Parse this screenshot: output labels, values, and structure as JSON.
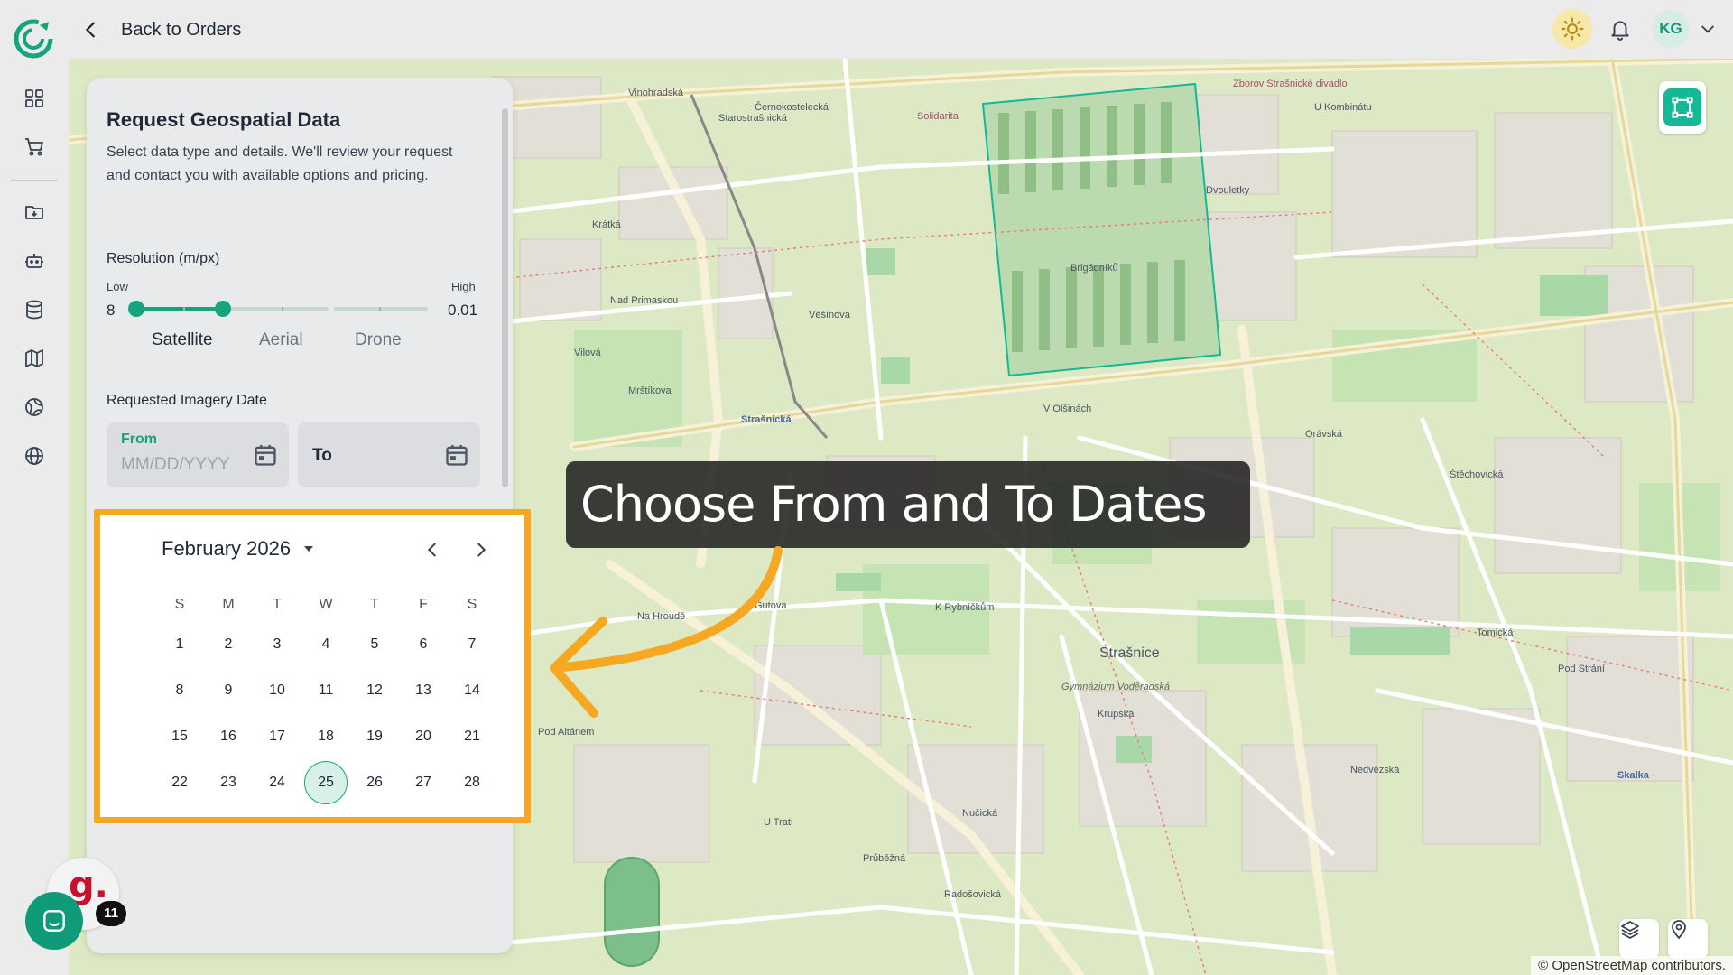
{
  "header": {
    "back_label": "Back to Orders",
    "avatar_initials": "KG"
  },
  "sidebar": {
    "icons": [
      "dashboard-icon",
      "cart-icon",
      "folder-icon",
      "robot-icon",
      "database-icon",
      "map-icon",
      "globe-grid-icon",
      "globe-icon"
    ]
  },
  "panel": {
    "title": "Request Geospatial Data",
    "description": "Select data type and details. We'll review your request and contact you with available options and pricing.",
    "resolution": {
      "label": "Resolution (m/px)",
      "low_label": "Low",
      "high_label": "High",
      "min_value": "8",
      "max_value": "0.01",
      "selected_fraction": 0.3,
      "sources": [
        "Satellite",
        "Aerial",
        "Drone"
      ],
      "active_source": "Satellite"
    },
    "date": {
      "label": "Requested Imagery Date",
      "from_label": "From",
      "from_placeholder": "MM/DD/YYYY",
      "to_label": "To"
    }
  },
  "calendar": {
    "month_label": "February 2026",
    "weekdays": [
      "S",
      "M",
      "T",
      "W",
      "T",
      "F",
      "S"
    ],
    "weeks": [
      [
        "1",
        "2",
        "3",
        "4",
        "5",
        "6",
        "7"
      ],
      [
        "8",
        "9",
        "10",
        "11",
        "12",
        "13",
        "14"
      ],
      [
        "15",
        "16",
        "17",
        "18",
        "19",
        "20",
        "21"
      ],
      [
        "22",
        "23",
        "24",
        "25",
        "26",
        "27",
        "28"
      ]
    ],
    "today": "25"
  },
  "callout": {
    "text": "Choose From and To Dates"
  },
  "map": {
    "attribution": "© OpenStreetMap contributors.",
    "street_labels": [
      "Vinohradská",
      "Černokostelecká",
      "U Kombinátu",
      "Dvouletky",
      "Brigádníků",
      "V Olšinách",
      "Strašnická",
      "Krátká",
      "Vilová",
      "Mrštíkova",
      "Na Hroudě",
      "Gutova",
      "K Rybníčkům",
      "Strašnice",
      "Průběžná",
      "Pod Altánem",
      "Nad Primaskou",
      "Věšínova",
      "Orávská",
      "Štěchovická",
      "Tomická",
      "Pod Strání",
      "Skalka",
      "Nedvězská",
      "Starostrašnická",
      "Nučická",
      "Krupská",
      "U Trati",
      "Radošovická",
      "Solidarita",
      "Gymnázium Voděradská",
      "Zborov Strašnické divadlo"
    ]
  },
  "chat": {
    "logo_letter": "g.",
    "badge_count": "11"
  },
  "colors": {
    "accent": "#14a57f",
    "highlight": "#f7a823",
    "callout_bg": "#222222"
  }
}
